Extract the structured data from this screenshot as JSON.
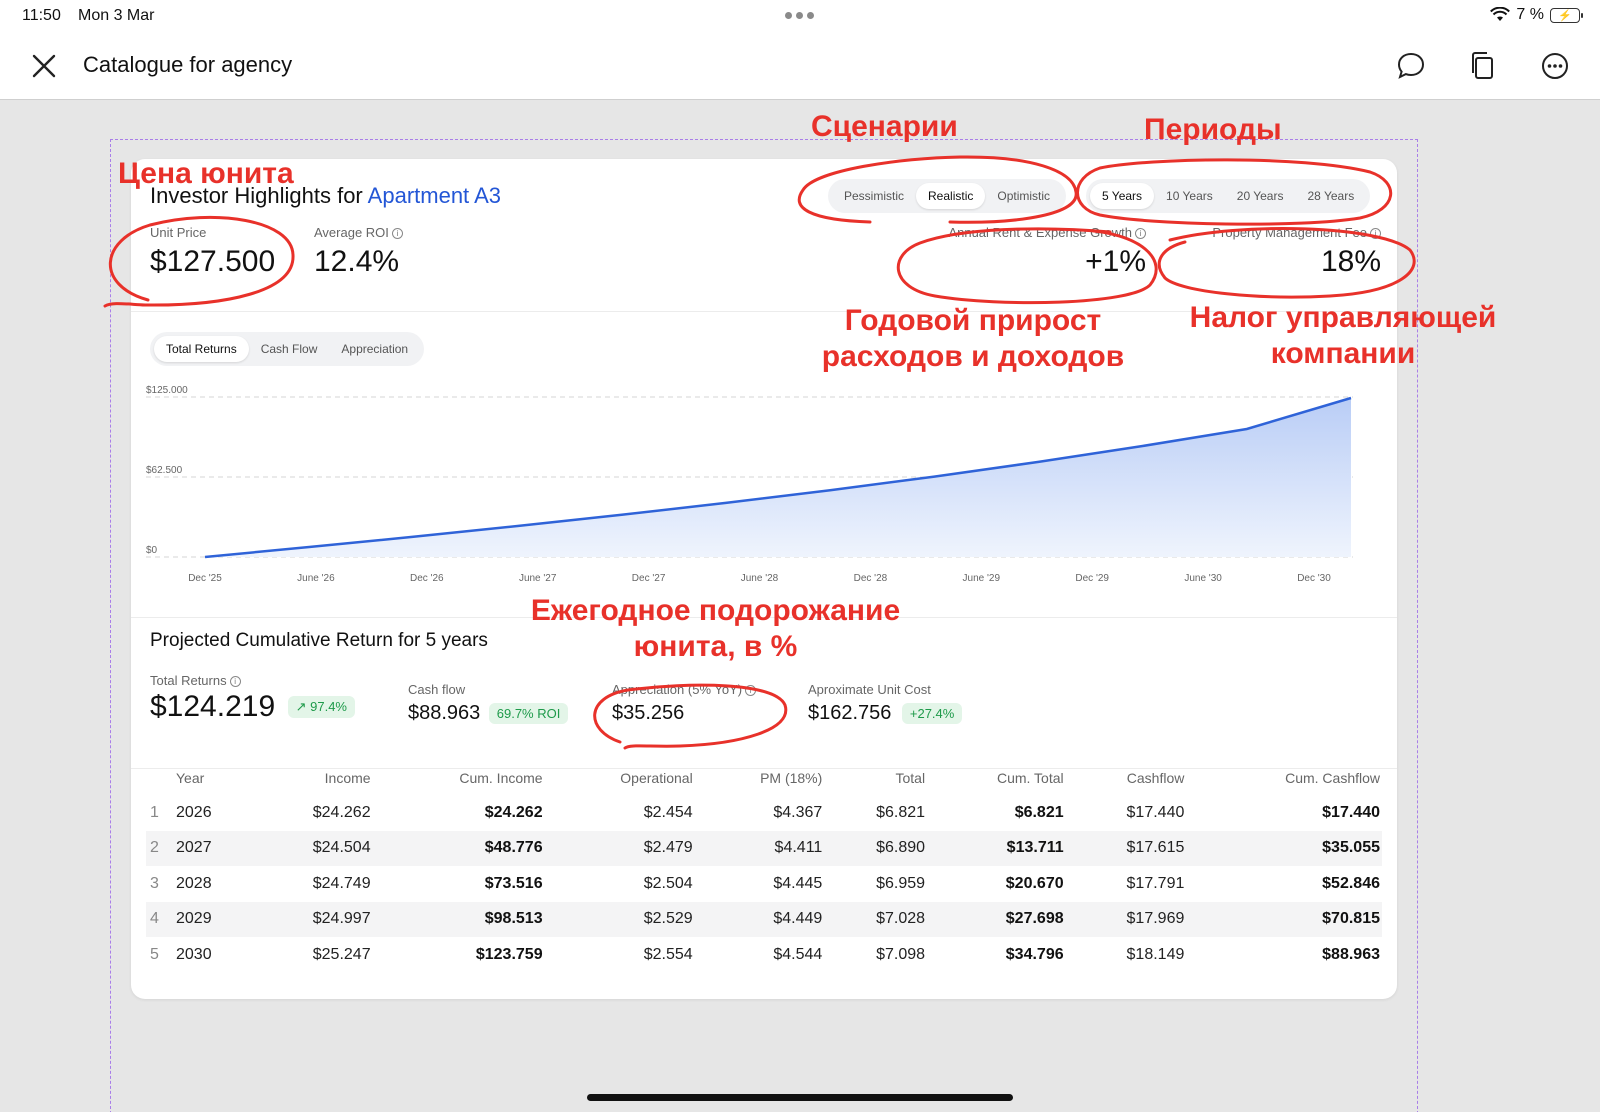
{
  "status": {
    "time": "11:50",
    "date": "Mon 3 Mar",
    "battery": "7 %"
  },
  "header": {
    "title": "Catalogue for agency",
    "icons": [
      "close-icon",
      "comment-icon",
      "copy-icon",
      "more-icon"
    ]
  },
  "investor": {
    "title_prefix": "Investor Highlights for",
    "title_apartment": "Apartment A3",
    "scenarios": [
      "Pessimistic",
      "Realistic",
      "Optimistic"
    ],
    "active_scenario": "Realistic",
    "periods": [
      "5 Years",
      "10 Years",
      "20 Years",
      "28 Years"
    ],
    "active_period": "5 Years",
    "unit_price_label": "Unit Price",
    "unit_price": "$127.500",
    "avg_roi_label": "Average ROI",
    "avg_roi": "12.4%",
    "growth_label": "Annual Rent & Expense Growth",
    "growth": "+1%",
    "pm_fee_label": "Property Management Fee",
    "pm_fee": "18%"
  },
  "chart_tabs": [
    "Total Returns",
    "Cash Flow",
    "Appreciation"
  ],
  "chart_data": {
    "type": "area",
    "title": "",
    "xlabel": "",
    "ylabel": "",
    "x_ticks": [
      "Dec '25",
      "June '26",
      "Dec '26",
      "June '27",
      "Dec '27",
      "June '28",
      "Dec '28",
      "June '29",
      "Dec '29",
      "June '30",
      "Dec '30"
    ],
    "y_ticks": [
      "$125.000",
      "$62.500",
      "$0"
    ],
    "ylim": [
      0,
      125000
    ],
    "grid": true,
    "color": "#2f63d8",
    "series": [
      {
        "values": [
          0,
          7800,
          15800,
          24200,
          33000,
          42300,
          52200,
          62800,
          74300,
          86700,
          100000,
          124219
        ]
      }
    ]
  },
  "projected": {
    "title": "Projected Cumulative Return for 5 years",
    "total_label": "Total Returns",
    "total_value": "$124.219",
    "total_chip": "97.4%",
    "cashflow_label": "Cash flow",
    "cashflow_value": "$88.963",
    "cashflow_chip": "69.7% ROI",
    "appreciation_label": "Appreciation (5% YoY)",
    "appreciation_value": "$35.256",
    "unit_cost_label": "Aproximate Unit Cost",
    "unit_cost_value": "$162.756",
    "unit_cost_chip": "+27.4%"
  },
  "table": {
    "headers": [
      "Year",
      "Income",
      "Cum. Income",
      "Operational",
      "PM (18%)",
      "Total",
      "Cum. Total",
      "Cashflow",
      "Cum. Cashflow"
    ],
    "rows": [
      [
        "1",
        "2026",
        "$24.262",
        "$24.262",
        "$2.454",
        "$4.367",
        "$6.821",
        "$6.821",
        "$17.440",
        "$17.440"
      ],
      [
        "2",
        "2027",
        "$24.504",
        "$48.776",
        "$2.479",
        "$4.411",
        "$6.890",
        "$13.711",
        "$17.615",
        "$35.055"
      ],
      [
        "3",
        "2028",
        "$24.749",
        "$73.516",
        "$2.504",
        "$4.445",
        "$6.959",
        "$20.670",
        "$17.791",
        "$52.846"
      ],
      [
        "4",
        "2029",
        "$24.997",
        "$98.513",
        "$2.529",
        "$4.449",
        "$7.028",
        "$27.698",
        "$17.969",
        "$70.815"
      ],
      [
        "5",
        "2030",
        "$25.247",
        "$123.759",
        "$2.554",
        "$4.544",
        "$7.098",
        "$34.796",
        "$18.149",
        "$88.963"
      ]
    ]
  },
  "annotations": {
    "scenarios": "Сценарии",
    "periods": "Периоды",
    "unit_price": "Цена юнита",
    "growth_line1": "Годовой прирост",
    "growth_line2": "расходов и доходов",
    "fee_line1": "Налог управляющей",
    "fee_line2": "компании",
    "appreciation_line1": "Ежегодное подорожание",
    "appreciation_line2": "юнита, в %"
  }
}
